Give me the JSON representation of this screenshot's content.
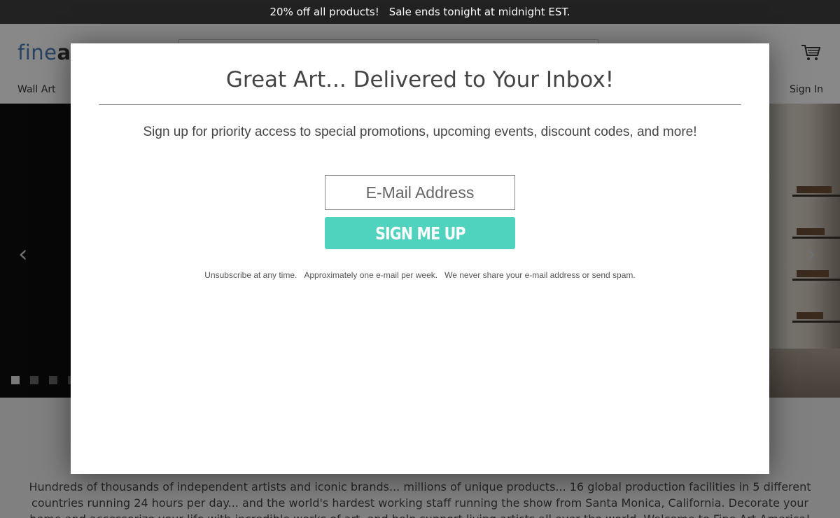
{
  "promo": {
    "part1": "20% off all products!",
    "part2": "Sale ends tonight at midnight EST."
  },
  "header": {
    "logo_light": "fine",
    "logo_bold": "art",
    "nav_left": "Wall Art",
    "nav_signin": "Sign In",
    "cart_icon": "cart-icon"
  },
  "hero": {
    "arrow_left": "‹",
    "arrow_right": "›",
    "slide_count": 4,
    "active_slide": 1
  },
  "blurb": "Hundreds of thousands of independent artists and iconic brands... millions of unique products... 16 global production facilities in 5 different countries running 24 hours per day... and the world's hardest working staff running the show from Santa Monica, California.   Decorate your home and accessorize your life with incredible works of art, and help support living artists all over the world.   Welcome to Fine Art America!",
  "modal": {
    "title": "Great Art... Delivered to Your Inbox!",
    "description": "Sign up for priority access to special promotions, upcoming events, discount codes, and more!",
    "email_placeholder": "E-Mail Address",
    "button_label": "SIGN ME UP",
    "fine1": "Unsubscribe at any time.",
    "fine2": "Approximately one e-mail per week.",
    "fine3": "We never share your e-mail address or send spam.",
    "accent_color": "#4fd3bf"
  }
}
